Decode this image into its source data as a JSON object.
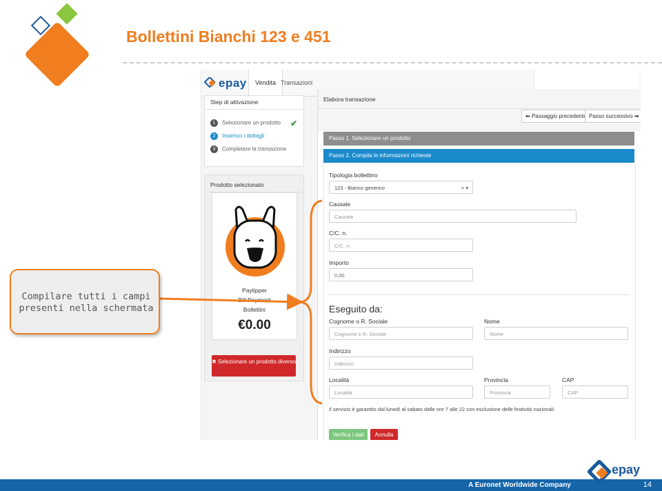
{
  "slide": {
    "title": "Bollettini Bianchi 123 e 451",
    "footer_company": "A Euronet Worldwide Company",
    "page_number": "14",
    "brand_color": "#f07d1e",
    "accent_color": "#1565a8"
  },
  "callout": {
    "line1": "Compilare tutti i campi",
    "line2": "presenti nella schermata"
  },
  "footer_logo_text": "epay",
  "app": {
    "logo_text": "epay",
    "nav_tabs": [
      {
        "label": "Vendita",
        "active": true
      },
      {
        "label": "Transazioni",
        "active": false
      }
    ],
    "steps_panel": {
      "title": "Step di attivazione",
      "steps": [
        {
          "num": "1",
          "label": "Selezionare un prodotto",
          "done": true
        },
        {
          "num": "2",
          "label": "Inserisci i dettagli",
          "active": true
        },
        {
          "num": "3",
          "label": "Completare la transazione"
        }
      ]
    },
    "product_panel": {
      "title": "Prodotto selezionato",
      "line1": "Paytipper",
      "line2": "Bill Payment",
      "line3": "Bollettini",
      "price": "€0.00",
      "change_button": "Selezionare un prodotto diverso"
    },
    "main": {
      "title": "Elabora transazione",
      "prev_button": "Passaggio precedente",
      "next_button": "Passo successivo",
      "step1_bar": "Passo 1. Selezionare un prodotto",
      "step2_bar": "Passo 2. Compila le informazioni richieste",
      "tipologia_label": "Tipologia bollettino",
      "tipologia_value": "123 - Bianco generico",
      "causale_label": "Causale",
      "causale_placeholder": "Causale",
      "cc_label": "C/C. n.",
      "cc_placeholder": "C/C. n.",
      "importo_label": "Importo",
      "importo_placeholder": "0,00",
      "eseguito_title": "Eseguito da:",
      "cognome_label": "Cognome o R. Sociale",
      "cognome_placeholder": "Cognome o R. Sociale",
      "nome_label": "Nome",
      "nome_placeholder": "Nome",
      "indirizzo_label": "Indirizzo",
      "indirizzo_placeholder": "Indirizzo",
      "localita_label": "Località",
      "localita_placeholder": "Località",
      "provincia_label": "Provincia",
      "provincia_placeholder": "Provincia",
      "cap_label": "CAP",
      "cap_placeholder": "CAP",
      "service_note": "Il servizio è garantito dal lunedì al sabato dalle ore 7 alle 22 con esclusione delle festività nazionali",
      "verify_button": "Verifica i dati",
      "cancel_button": "Annulla"
    }
  }
}
